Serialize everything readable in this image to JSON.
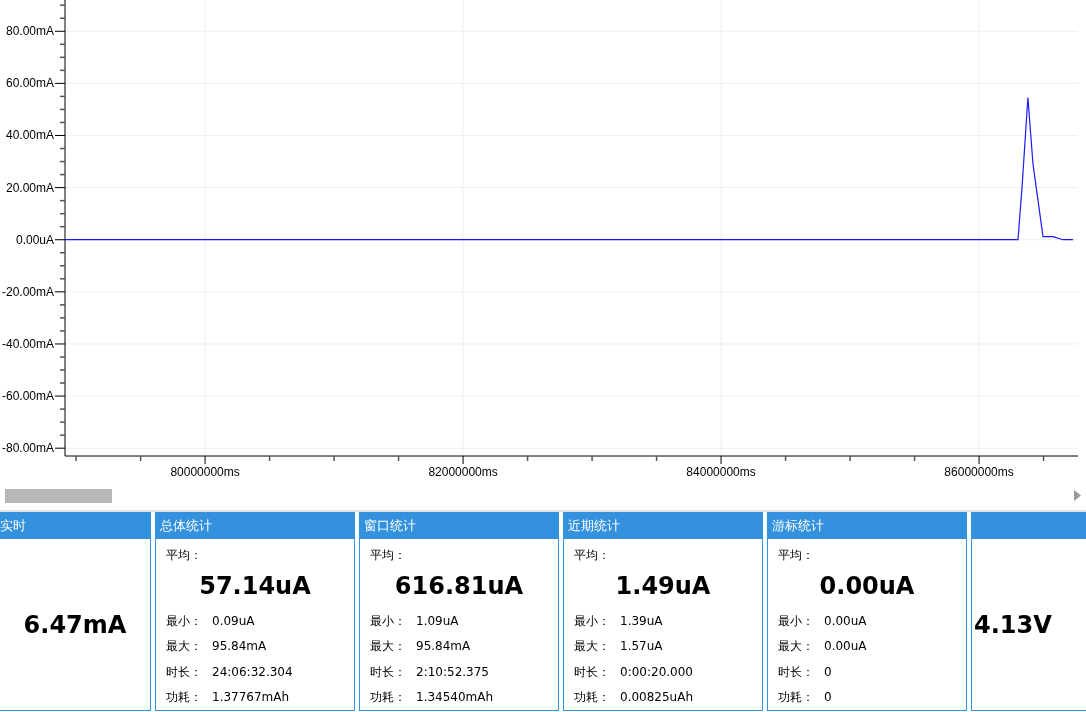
{
  "chart": {
    "chart_data": {
      "type": "line",
      "grid": true,
      "xlim": [
        78914000,
        86767000
      ],
      "ylim": [
        -83,
        92
      ],
      "xticks": [
        {
          "value": 80000000,
          "label": "80000000ms"
        },
        {
          "value": 82000000,
          "label": "82000000ms"
        },
        {
          "value": 84000000,
          "label": "84000000ms"
        },
        {
          "value": 86000000,
          "label": "86000000ms"
        }
      ],
      "yticks": [
        {
          "value": 80,
          "label": "80.00mA"
        },
        {
          "value": 60,
          "label": "60.00mA"
        },
        {
          "value": 40,
          "label": "40.00mA"
        },
        {
          "value": 20,
          "label": "20.00mA"
        },
        {
          "value": 0,
          "label": "0.00uA"
        },
        {
          "value": -20,
          "label": "-20.00mA"
        },
        {
          "value": -40,
          "label": "-40.00mA"
        },
        {
          "value": -60,
          "label": "-60.00mA"
        },
        {
          "value": -80,
          "label": "-80.00mA"
        }
      ],
      "x": [
        78914000,
        86302000,
        86333000,
        86379000,
        86418000,
        86496000,
        86573000,
        86651000,
        86728000
      ],
      "series": [
        {
          "color": "#1a1aff",
          "values": [
            0,
            0,
            20,
            54.6,
            29,
            1.2,
            1.2,
            0,
            0
          ]
        }
      ]
    }
  },
  "scrollbar": {
    "level": 0.1
  },
  "panels": [
    {
      "kind": "realtime",
      "title": "实时",
      "value": "6.47mA"
    },
    {
      "kind": "stats",
      "title": "总体统计",
      "avg_label": "平均：",
      "value": "57.14uA",
      "rows": [
        {
          "label": "最小：",
          "value": "0.09uA"
        },
        {
          "label": "最大：",
          "value": "95.84mA"
        },
        {
          "label": "时长：",
          "value": "24:06:32.304"
        },
        {
          "label": "功耗：",
          "value": "1.37767mAh"
        }
      ]
    },
    {
      "kind": "stats",
      "title": "窗口统计",
      "avg_label": "平均：",
      "value": "616.81uA",
      "rows": [
        {
          "label": "最小：",
          "value": "1.09uA"
        },
        {
          "label": "最大：",
          "value": "95.84mA"
        },
        {
          "label": "时长：",
          "value": "2:10:52.375"
        },
        {
          "label": "功耗：",
          "value": "1.34540mAh"
        }
      ]
    },
    {
      "kind": "stats",
      "title": "近期统计",
      "avg_label": "平均：",
      "value": "1.49uA",
      "rows": [
        {
          "label": "最小：",
          "value": "1.39uA"
        },
        {
          "label": "最大：",
          "value": "1.57uA"
        },
        {
          "label": "时长：",
          "value": "0:00:20.000"
        },
        {
          "label": "功耗：",
          "value": "0.00825uAh"
        }
      ]
    },
    {
      "kind": "stats",
      "title": "游标统计",
      "avg_label": "平均：",
      "value": "0.00uA",
      "rows": [
        {
          "label": "最小：",
          "value": "0.00uA"
        },
        {
          "label": "最大：",
          "value": "0.00uA"
        },
        {
          "label": "时长：",
          "value": "0"
        },
        {
          "label": "功耗：",
          "value": "0"
        }
      ]
    },
    {
      "kind": "voltage",
      "value": "4.13V"
    }
  ]
}
